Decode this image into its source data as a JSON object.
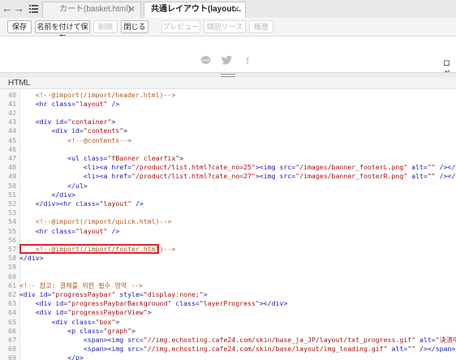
{
  "tabs": [
    {
      "label": "カート(basket.html)",
      "active": false
    },
    {
      "label": "共通レイアウト(layout...",
      "active": true
    }
  ],
  "toolbar": {
    "save": "保存",
    "save_as": "名前を付けて保存",
    "delete": "削除",
    "close": "閉じる",
    "preview": "プレビュー",
    "source": "個別ソース",
    "history": "履歴"
  },
  "preview": {
    "login_text": "ログ"
  },
  "section_title": "HTML",
  "code_lines": [
    {
      "n": "40",
      "code": "    <!--@import(/import/header.html)-->"
    },
    {
      "n": "41",
      "code": "    <hr class=\"layout\" />"
    },
    {
      "n": "42",
      "code": ""
    },
    {
      "n": "43",
      "code": "    <div id=\"container\">"
    },
    {
      "n": "44",
      "code": "        <div id=\"contents\">"
    },
    {
      "n": "45",
      "code": "            <!--@contents-->"
    },
    {
      "n": "46",
      "code": ""
    },
    {
      "n": "47",
      "code": "            <ul class=\"fBanner clearfix\">"
    },
    {
      "n": "48",
      "code": "                <li><a href=\"/product/list.html?cate_no=25\"><img src=\"/images/banner_footerL.png\" alt=\"\" /></a></li>"
    },
    {
      "n": "49",
      "code": "                <li><a href=\"/product/list.html?cate_no=27\"><img src=\"/images/banner_footerR.png\" alt=\"\" /></a></li>"
    },
    {
      "n": "50",
      "code": "            </ul>"
    },
    {
      "n": "51",
      "code": "        </div>"
    },
    {
      "n": "52",
      "code": "    </div><hr class=\"layout\" />"
    },
    {
      "n": "53",
      "code": ""
    },
    {
      "n": "54",
      "code": "    <!--@import(/import/quick.html)-->"
    },
    {
      "n": "55",
      "code": "    <hr class=\"layout\" />"
    },
    {
      "n": "56",
      "code": ""
    },
    {
      "n": "57",
      "code": "    <!--@import(/import/footer.html)-->"
    },
    {
      "n": "58",
      "code": "</div>"
    },
    {
      "n": "59",
      "code": ""
    },
    {
      "n": "60",
      "code": ""
    },
    {
      "n": "61",
      "code": "<!-- 참고: 결제를 위한 필수 영역 -->"
    },
    {
      "n": "62",
      "code": "<div id=\"progressPaybar\" style=\"display:none;\">"
    },
    {
      "n": "63",
      "code": "    <div id=\"progressPaybarBackground\" class=\"layerProgress\"></div>"
    },
    {
      "n": "64",
      "code": "    <div id=\"progressPaybarView\">"
    },
    {
      "n": "65",
      "code": "        <div class=\"box\">"
    },
    {
      "n": "66",
      "code": "            <p class=\"graph\">"
    },
    {
      "n": "67",
      "code": "                <span><img src=\"//img.echosting.cafe24.com/skin/base_ja_JP/layout/txt_progress.gif\" alt=\"決済中です。\" /></span>"
    },
    {
      "n": "68",
      "code": "                <span><img src=\"//img.echosting.cafe24.com/skin/base/layout/img_loading.gif\" alt=\"\" /></span>"
    },
    {
      "n": "69",
      "code": "            </p>"
    }
  ],
  "highlight_line": "57",
  "colors": {
    "highlight_border": "#e0232a",
    "comment": "#b35a1f",
    "tag": "#1a1aa6",
    "value": "#a31515"
  }
}
